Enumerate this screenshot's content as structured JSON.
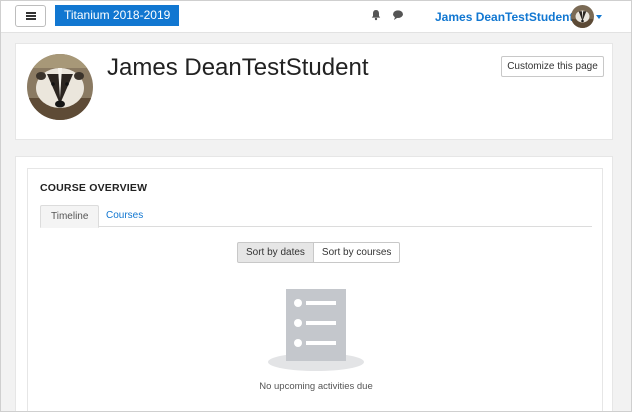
{
  "navbar": {
    "site_name": "Titanium 2018-2019",
    "user_name": "James DeanTestStudent",
    "icons": {
      "menu": "hamburger-menu-icon",
      "notifications": "bell-icon",
      "messages": "chat-bubble-icon",
      "user_menu": "caret-down-icon"
    }
  },
  "header": {
    "name": "James DeanTestStudent",
    "customize_label": "Customize this page"
  },
  "course_overview": {
    "title": "COURSE OVERVIEW",
    "tabs": [
      {
        "label": "Timeline",
        "active": true
      },
      {
        "label": "Courses",
        "active": false
      }
    ],
    "sort_buttons": [
      {
        "label": "Sort by dates",
        "active": true
      },
      {
        "label": "Sort by courses",
        "active": false
      }
    ],
    "empty_message": "No upcoming activities due"
  },
  "colors": {
    "accent": "#1177d1",
    "page_background": "#f2f2f2",
    "illustration": "#c4c7cc"
  }
}
